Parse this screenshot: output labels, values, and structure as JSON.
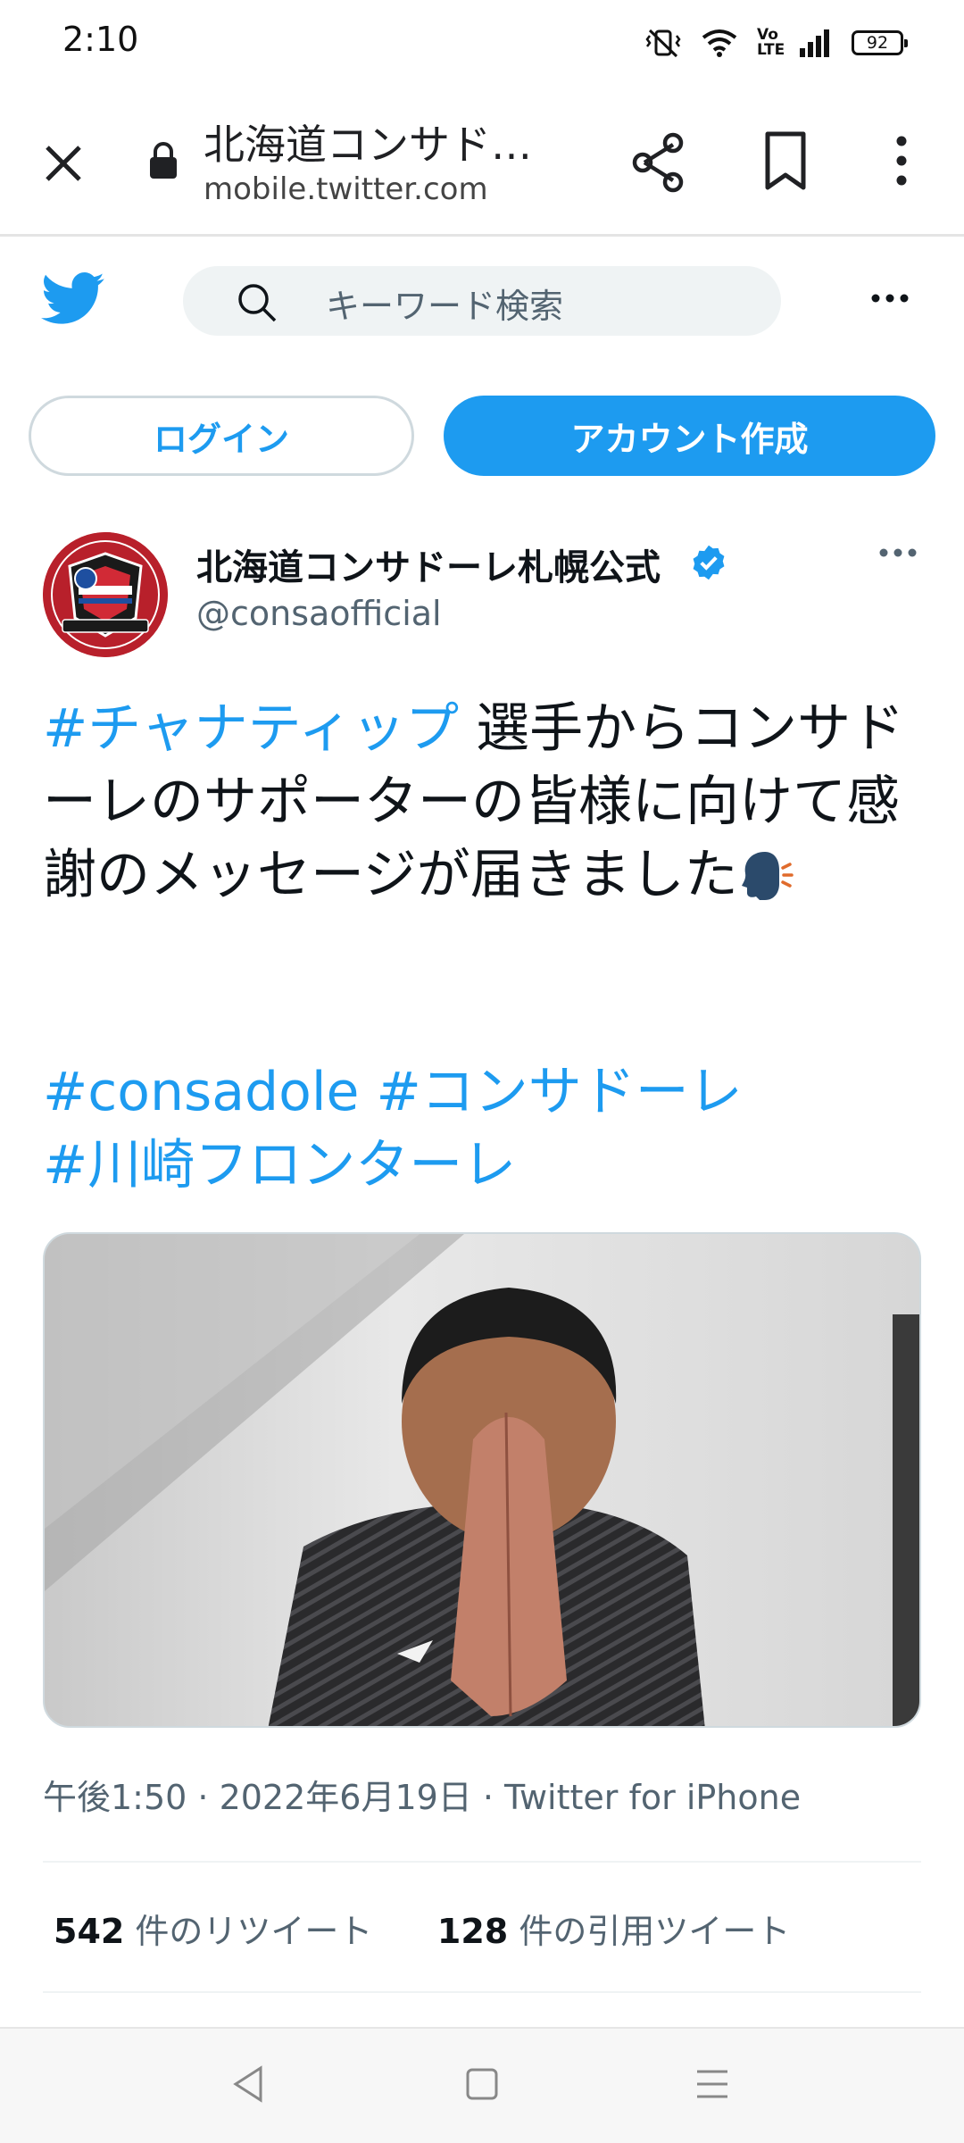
{
  "status_bar": {
    "time": "2:10",
    "volte_label": "Vo LTE",
    "battery_level": "92"
  },
  "browser": {
    "page_title": "北海道コンサド…",
    "url": "mobile.twitter.com"
  },
  "twitter": {
    "search_placeholder": "キーワード検索",
    "login_label": "ログイン",
    "signup_label": "アカウント作成",
    "accent_color": "#1d9bf0"
  },
  "tweet": {
    "author_name": "北海道コンサドーレ札幌公式",
    "author_handle": "@consaofficial",
    "verified": true,
    "hashtag_1": "#チャナティップ",
    "body_text": " 選手からコンサドーレのサポーターの皆様に向けて感謝のメッセージが届きました",
    "tags_line_1": "#consadole #コンサドーレ",
    "tags_line_2": "#川崎フロンターレ",
    "timestamp": "午後1:50 · 2022年6月19日 · Twitter for iPhone",
    "retweet_count": "542",
    "retweet_label": "件のリツイート",
    "quote_count": "128",
    "quote_label": "件の引用ツイート"
  }
}
